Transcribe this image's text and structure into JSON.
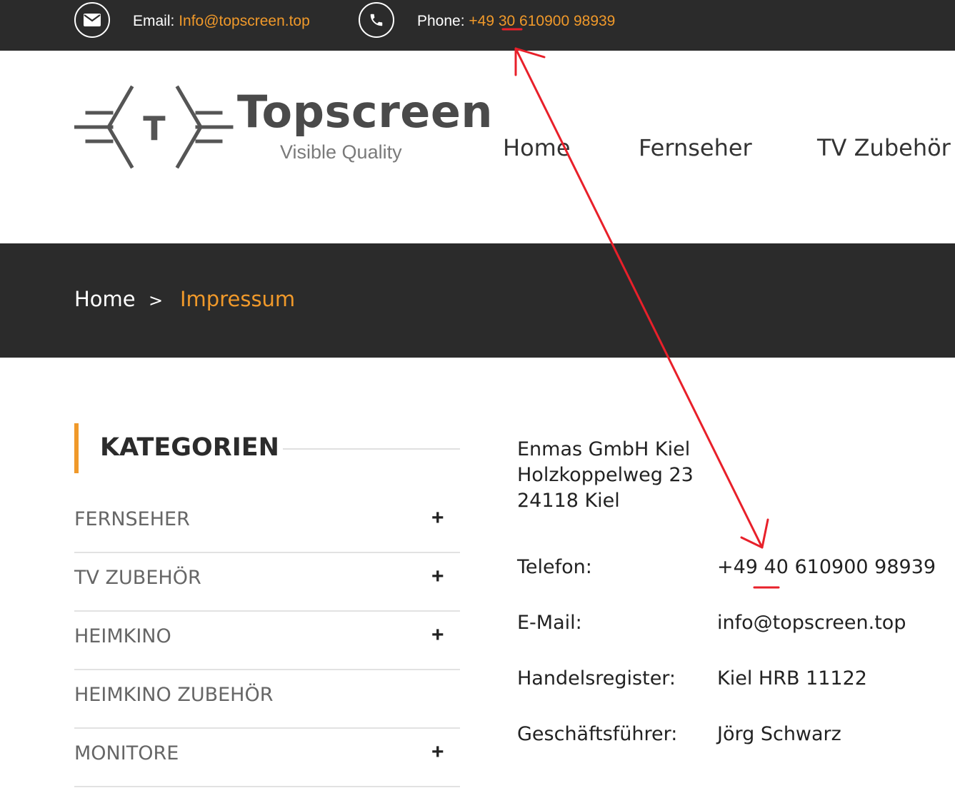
{
  "topbar": {
    "email_prefix": "Email: ",
    "email_value": "Info@topscreen.top",
    "phone_prefix": "Phone: ",
    "phone_value": "+49 30 610900 98939"
  },
  "brand": {
    "name": "Topscreen",
    "tagline": "Visible Quality",
    "monogram": "T"
  },
  "nav": [
    "Home",
    "Fernseher",
    "TV Zubehör"
  ],
  "breadcrumb": {
    "home": "Home",
    "separator": ">",
    "current": "Impressum"
  },
  "sidebar": {
    "title": "KATEGORIEN",
    "items": [
      {
        "label": "FERNSEHER",
        "expand": "+"
      },
      {
        "label": "TV ZUBEHÖR",
        "expand": "+"
      },
      {
        "label": "HEIMKINO",
        "expand": "+"
      },
      {
        "label": "HEIMKINO ZUBEHÖR",
        "expand": ""
      },
      {
        "label": "MONITORE",
        "expand": "+"
      }
    ]
  },
  "address": [
    "Enmas GmbH Kiel",
    "Holzkoppelweg 23",
    "24118 Kiel"
  ],
  "info": [
    {
      "label": "Telefon:",
      "value": "+49 40 610900 98939"
    },
    {
      "label": "E-Mail:",
      "value": "info@topscreen.top"
    },
    {
      "label": "Handelsregister:",
      "value": "Kiel HRB 11122"
    },
    {
      "label": "Geschäftsführer:",
      "value": "Jörg Schwarz"
    }
  ],
  "colors": {
    "accent": "#f0992a",
    "dark_band": "#2b2b2b",
    "annotation": "#e8202a"
  },
  "icons": [
    "envelope-icon",
    "phone-icon"
  ]
}
